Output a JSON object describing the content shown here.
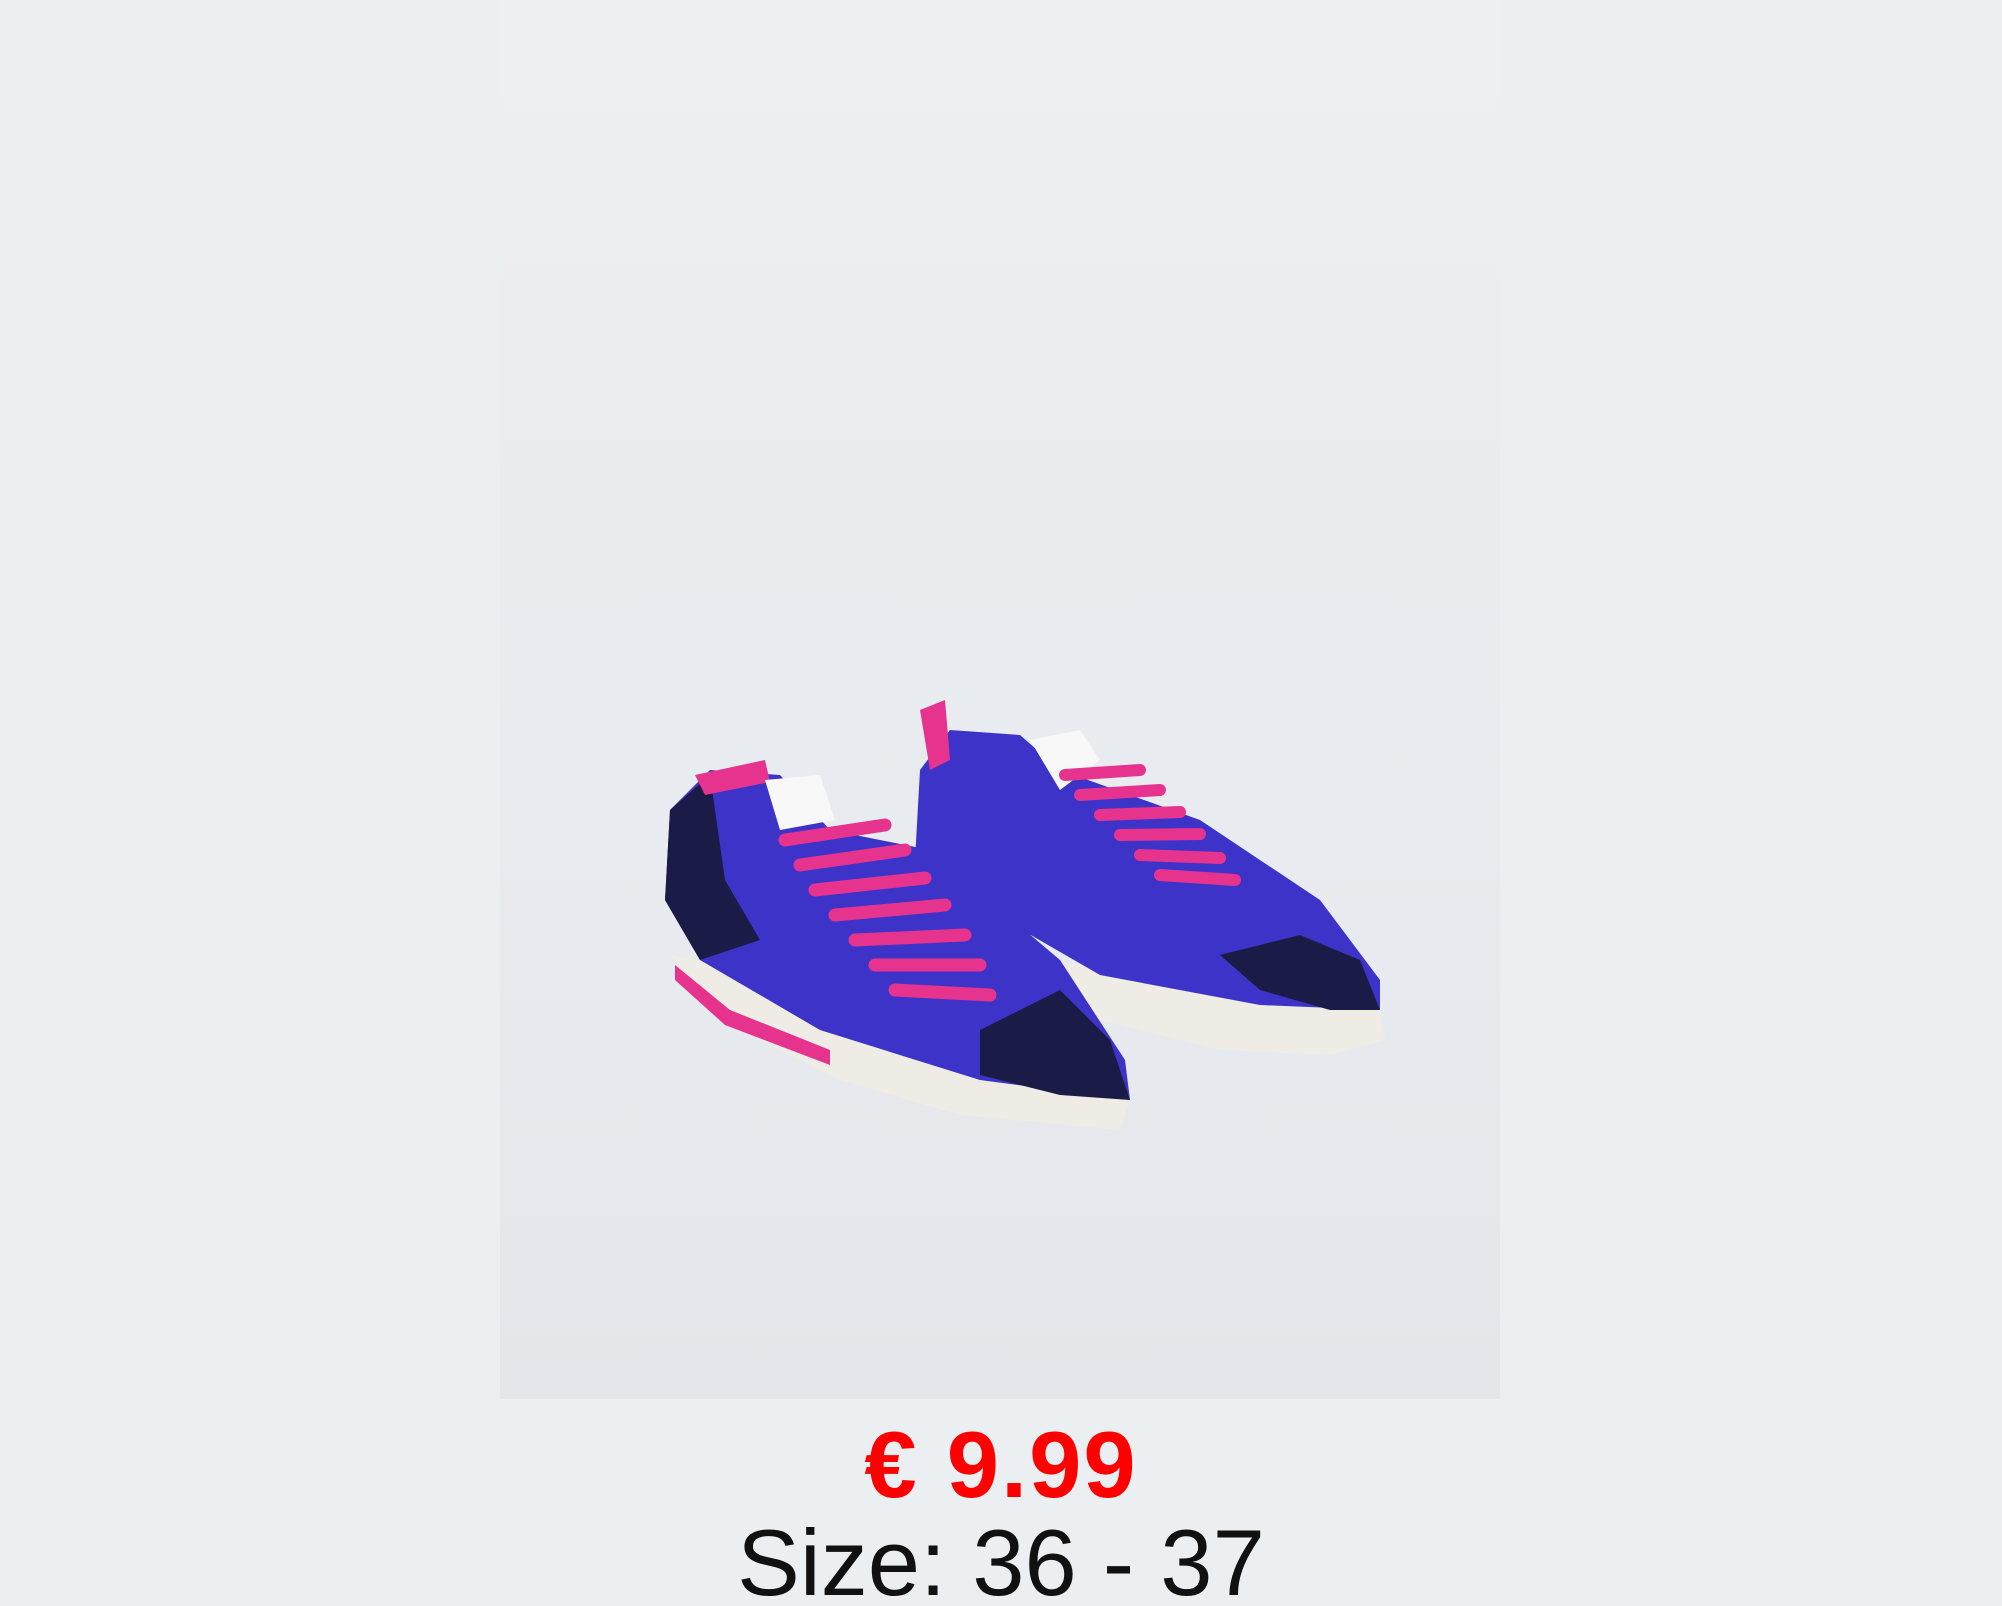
{
  "product": {
    "image_alt": "blue sneakers with pink laces",
    "price": "€ 9.99",
    "size": "Size: 36 - 37"
  },
  "colors": {
    "price": "#ff0000",
    "background": "#eceff1",
    "shoe_blue": "#3d33c9",
    "shoe_navy": "#1b1b48",
    "laces_pink": "#e6338e",
    "sole": "#eeece4"
  }
}
